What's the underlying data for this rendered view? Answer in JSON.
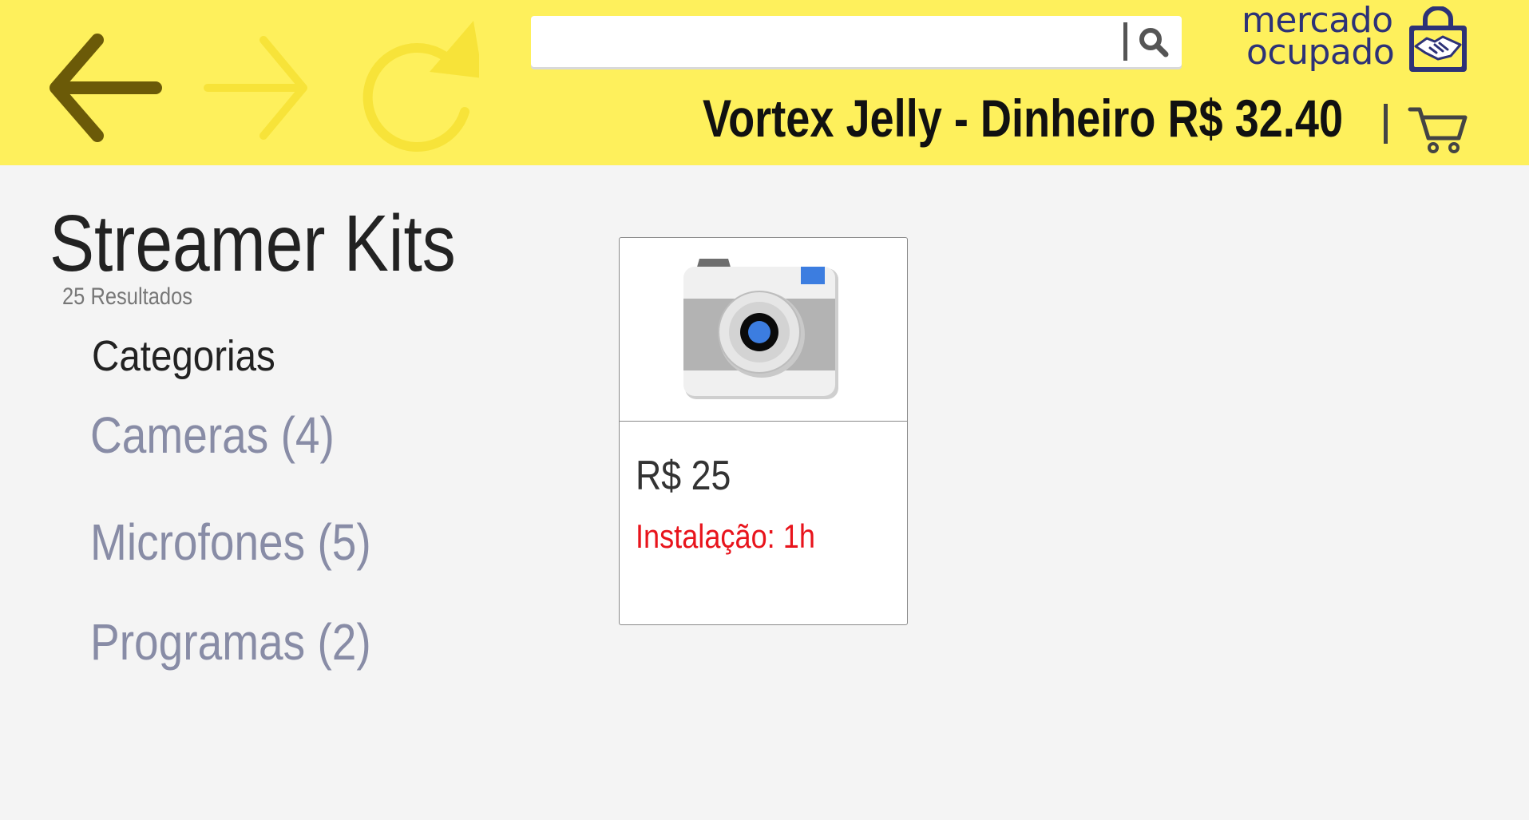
{
  "header": {
    "search": {
      "value": "",
      "placeholder": ""
    },
    "logo": {
      "line1": "mercado",
      "line2": "ocupado"
    },
    "account_info": "Vortex Jelly - Dinheiro R$ 32.40"
  },
  "main": {
    "title": "Streamer Kits",
    "results_count": "25 Resultados",
    "categories_heading": "Categorias",
    "categories": [
      {
        "label": "Cameras (4)"
      },
      {
        "label": "Microfones (5)"
      },
      {
        "label": "Programas (2)"
      }
    ]
  },
  "products": [
    {
      "price": "R$ 25",
      "install": "Instalação: 1h",
      "icon": "camera-icon"
    }
  ],
  "colors": {
    "header_bg": "#fef05c",
    "logo_blue": "#2d3277",
    "category_link": "#888ca6",
    "install_red": "#e8141c",
    "back_arrow": "#6b5a08",
    "inactive_nav": "#f7e339"
  }
}
